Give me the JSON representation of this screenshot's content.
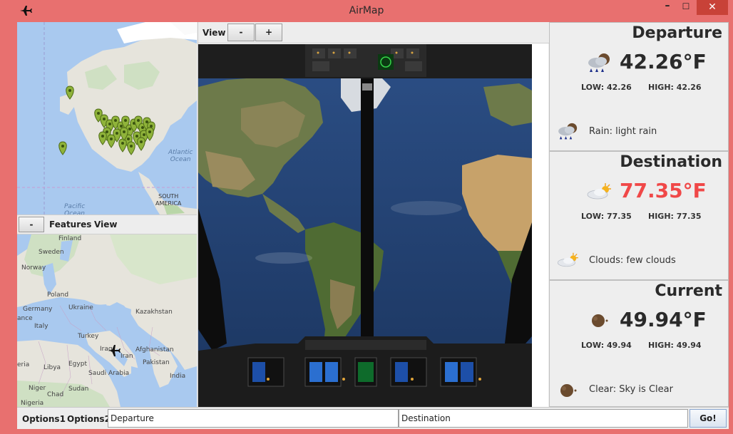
{
  "window": {
    "title": "AirMap",
    "app_icon": "airplane-icon",
    "controls": {
      "minimize": "–",
      "maximize": "☐",
      "close": "✕"
    }
  },
  "map_top": {
    "labels": {
      "atlantic": "Atlantic\nOcean",
      "pacific": "Pacific\nOcean",
      "south_america": "SOUTH\nAMERICA"
    },
    "marker_icon": "map-pin-icon"
  },
  "map_toolbar": {
    "minus_button": "-",
    "features_label": "Features",
    "view_label": "View"
  },
  "map_bottom": {
    "labels": {
      "finland": "Finland",
      "sweden": "Sweden",
      "norway": "Norway",
      "poland": "Poland",
      "germany": "Germany",
      "ukraine": "Ukraine",
      "kazakhstan": "Kazakhstan",
      "ance": "ance",
      "italy": "Italy",
      "turkey": "Turkey",
      "iraq": "Iraq",
      "iran": "Iran",
      "afghanistan": "Afghanistan",
      "pakistan": "Pakistan",
      "eria": "eria",
      "libya": "Libya",
      "egypt": "Egypt",
      "saudi_arabia": "Saudi Arabia",
      "india": "India",
      "niger": "Niger",
      "chad": "Chad",
      "sudan": "Sudan",
      "nigeria": "Nigeria"
    },
    "plane_icon": "airplane-icon"
  },
  "center_toolbar": {
    "view_label": "View",
    "zoom_out": "-",
    "zoom_in": "+"
  },
  "weather": [
    {
      "title": "Departure",
      "temp": "42.26°F",
      "low": "LOW: 42.26",
      "high": "HIGH: 42.26",
      "description": "Rain: light rain",
      "icon": "rain-cloud-icon",
      "temp_color": "#2a2a2a"
    },
    {
      "title": "Destination",
      "temp": "77.35°F",
      "low": "LOW: 77.35",
      "high": "HIGH: 77.35",
      "description": "Clouds: few clouds",
      "icon": "sun-cloud-icon",
      "temp_color": "#f04848"
    },
    {
      "title": "Current",
      "temp": "49.94°F",
      "low": "LOW: 49.94",
      "high": "HIGH: 49.94",
      "description": "Clear: Sky is Clear",
      "icon": "moon-icon",
      "temp_color": "#2a2a2a"
    }
  ],
  "bottom_bar": {
    "options1": "Options1",
    "options2": "Options2",
    "departure_value": "Departure",
    "destination_value": "Destination",
    "go_button": "Go!"
  },
  "colors": {
    "titlebar": "#e8706f",
    "close_button": "#c84238",
    "warm_temp": "#f04848"
  }
}
